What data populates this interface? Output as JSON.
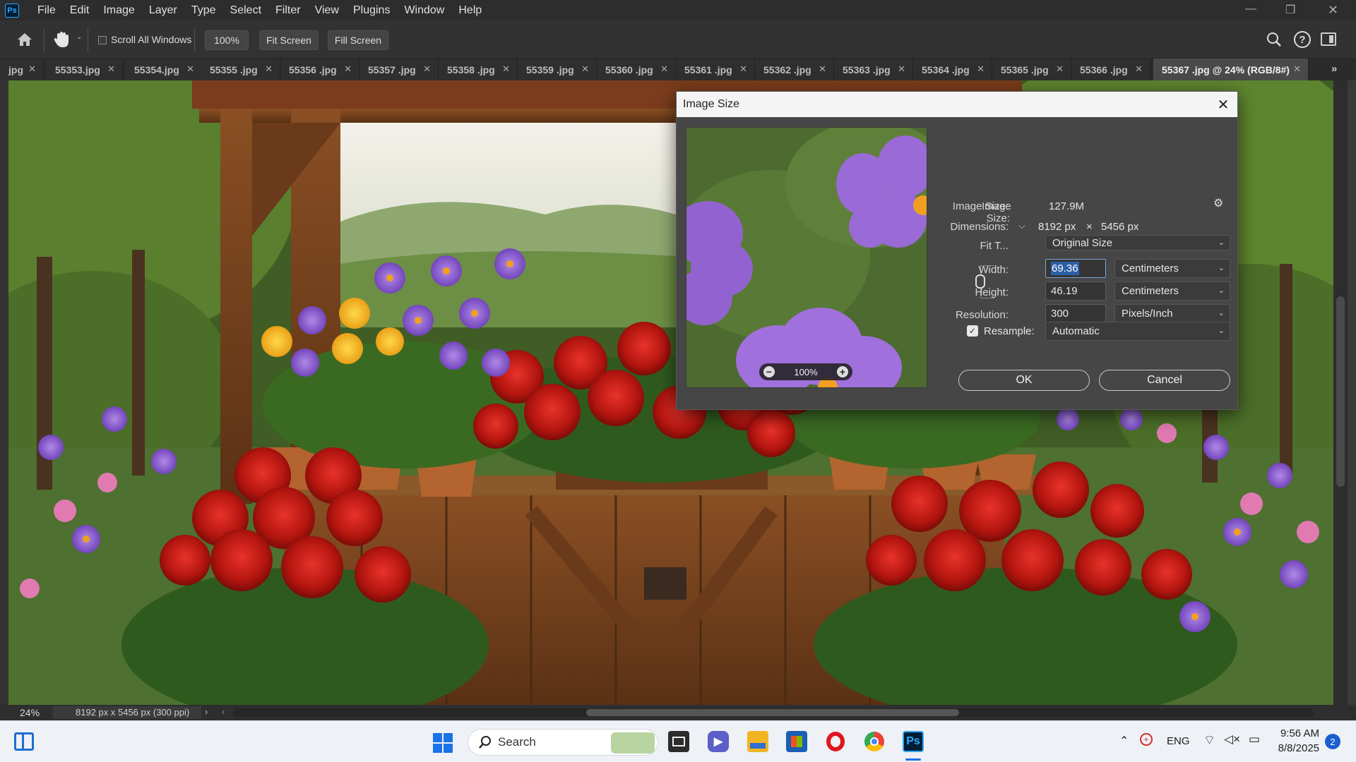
{
  "app": {
    "logo": "Ps",
    "menu": [
      "File",
      "Edit",
      "Image",
      "Layer",
      "Type",
      "Select",
      "Filter",
      "View",
      "Plugins",
      "Window",
      "Help"
    ]
  },
  "options_bar": {
    "scroll_all_windows_label": "Scroll All Windows",
    "scroll_all_windows_checked": false,
    "zoom_value": "100%",
    "fit_screen_label": "Fit Screen",
    "fill_screen_label": "Fill Screen"
  },
  "tabs": [
    {
      "label": "jpg",
      "active": false
    },
    {
      "label": "55353.jpg",
      "active": false
    },
    {
      "label": "55354.jpg",
      "active": false
    },
    {
      "label": "55355 .jpg",
      "active": false
    },
    {
      "label": "55356 .jpg",
      "active": false
    },
    {
      "label": "55357 .jpg",
      "active": false
    },
    {
      "label": "55358 .jpg",
      "active": false
    },
    {
      "label": "55359 .jpg",
      "active": false
    },
    {
      "label": "55360 .jpg",
      "active": false
    },
    {
      "label": "55361 .jpg",
      "active": false
    },
    {
      "label": "55362 .jpg",
      "active": false
    },
    {
      "label": "55363 .jpg",
      "active": false
    },
    {
      "label": "55364 .jpg",
      "active": false
    },
    {
      "label": "55365 .jpg",
      "active": false
    },
    {
      "label": "55366 .jpg",
      "active": false
    },
    {
      "label": "55367 .jpg @ 24% (RGB/8#)",
      "active": true
    }
  ],
  "status_bar": {
    "zoom": "24%",
    "doc_info": "8192 px x 5456 px (300 ppi)"
  },
  "dialog": {
    "title": "Image Size",
    "image_size_label": "Image Size:",
    "image_size_value": "127.9M",
    "dimensions_label": "Dimensions:",
    "dimensions_width": "8192 px",
    "dimensions_x": "×",
    "dimensions_height": "5456 px",
    "fit_to_label": "Fit T...",
    "fit_to_value": "Original Size",
    "width_label": "Width:",
    "width_value": "69.36",
    "width_unit": "Centimeters",
    "height_label": "Height:",
    "height_value": "46.19",
    "height_unit": "Centimeters",
    "resolution_label": "Resolution:",
    "resolution_value": "300",
    "resolution_unit": "Pixels/Inch",
    "resample_label": "Resample:",
    "resample_checked": true,
    "resample_value": "Automatic",
    "preview_zoom": "100%",
    "ok_label": "OK",
    "cancel_label": "Cancel"
  },
  "taskbar": {
    "search_placeholder": "Search",
    "language": "ENG",
    "time": "9:56 AM",
    "date": "8/8/2025",
    "notification_count": "2",
    "photoshop_label": "Ps"
  },
  "colors": {
    "accent": "#31a8ff",
    "dialog_bg": "#464646",
    "selection": "#2d5fa8",
    "taskbar_bg": "#eef1f6"
  }
}
